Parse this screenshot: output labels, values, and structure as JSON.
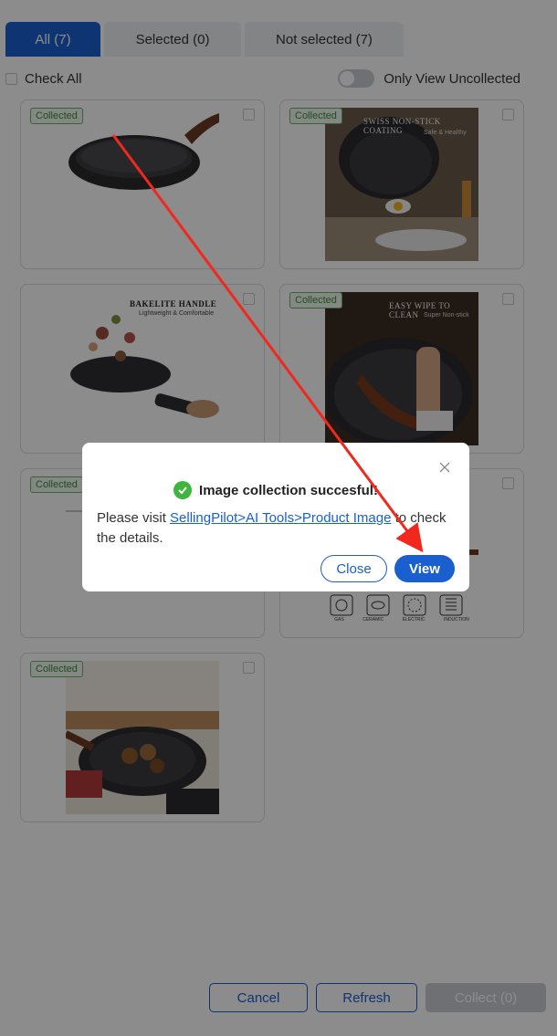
{
  "tabs": [
    {
      "label": "All (7)",
      "active": true
    },
    {
      "label": "Selected (0)",
      "active": false
    },
    {
      "label": "Not selected (7)",
      "active": false
    }
  ],
  "options": {
    "check_all_label": "Check All",
    "only_view_label": "Only View Uncollected",
    "only_view_enabled": false
  },
  "cards": [
    {
      "badge": "Collected",
      "image": "frying-pan"
    },
    {
      "badge": "Collected",
      "image": "pan-with-egg",
      "overlay_title": "SWISS NON-STICK COATING",
      "overlay_sub": "Safe & Healthy"
    },
    {
      "badge": "",
      "image": "pan-with-food-toss",
      "overlay_title": "BAKELITE HANDLE",
      "overlay_sub": "Lightweight & Comfortable"
    },
    {
      "badge": "Collected",
      "image": "pan-wipe",
      "overlay_title": "EASY WIPE TO CLEAN",
      "overlay_sub": "Super Non-stick"
    },
    {
      "badge": "Collected",
      "image": "pan-dimensions"
    },
    {
      "badge": "",
      "image": "stovetop-compatibility",
      "stove_labels": [
        "GAS",
        "CERAMIC",
        "ELECTRIC",
        "INDUCTION"
      ]
    },
    {
      "badge": "Collected",
      "image": "pan-lifestyle"
    }
  ],
  "footer": {
    "cancel_label": "Cancel",
    "refresh_label": "Refresh",
    "collect_label": "Collect (0)"
  },
  "modal": {
    "title": "Image collection succesful!",
    "body_prefix": "Please visit ",
    "link_text": "SellingPilot>AI Tools>Product Image",
    "body_suffix": " to check the details.",
    "close_label": "Close",
    "view_label": "View"
  },
  "colors": {
    "accent": "#1a5fd0",
    "success": "#3fb43f",
    "annotation_arrow": "#f0281e"
  }
}
